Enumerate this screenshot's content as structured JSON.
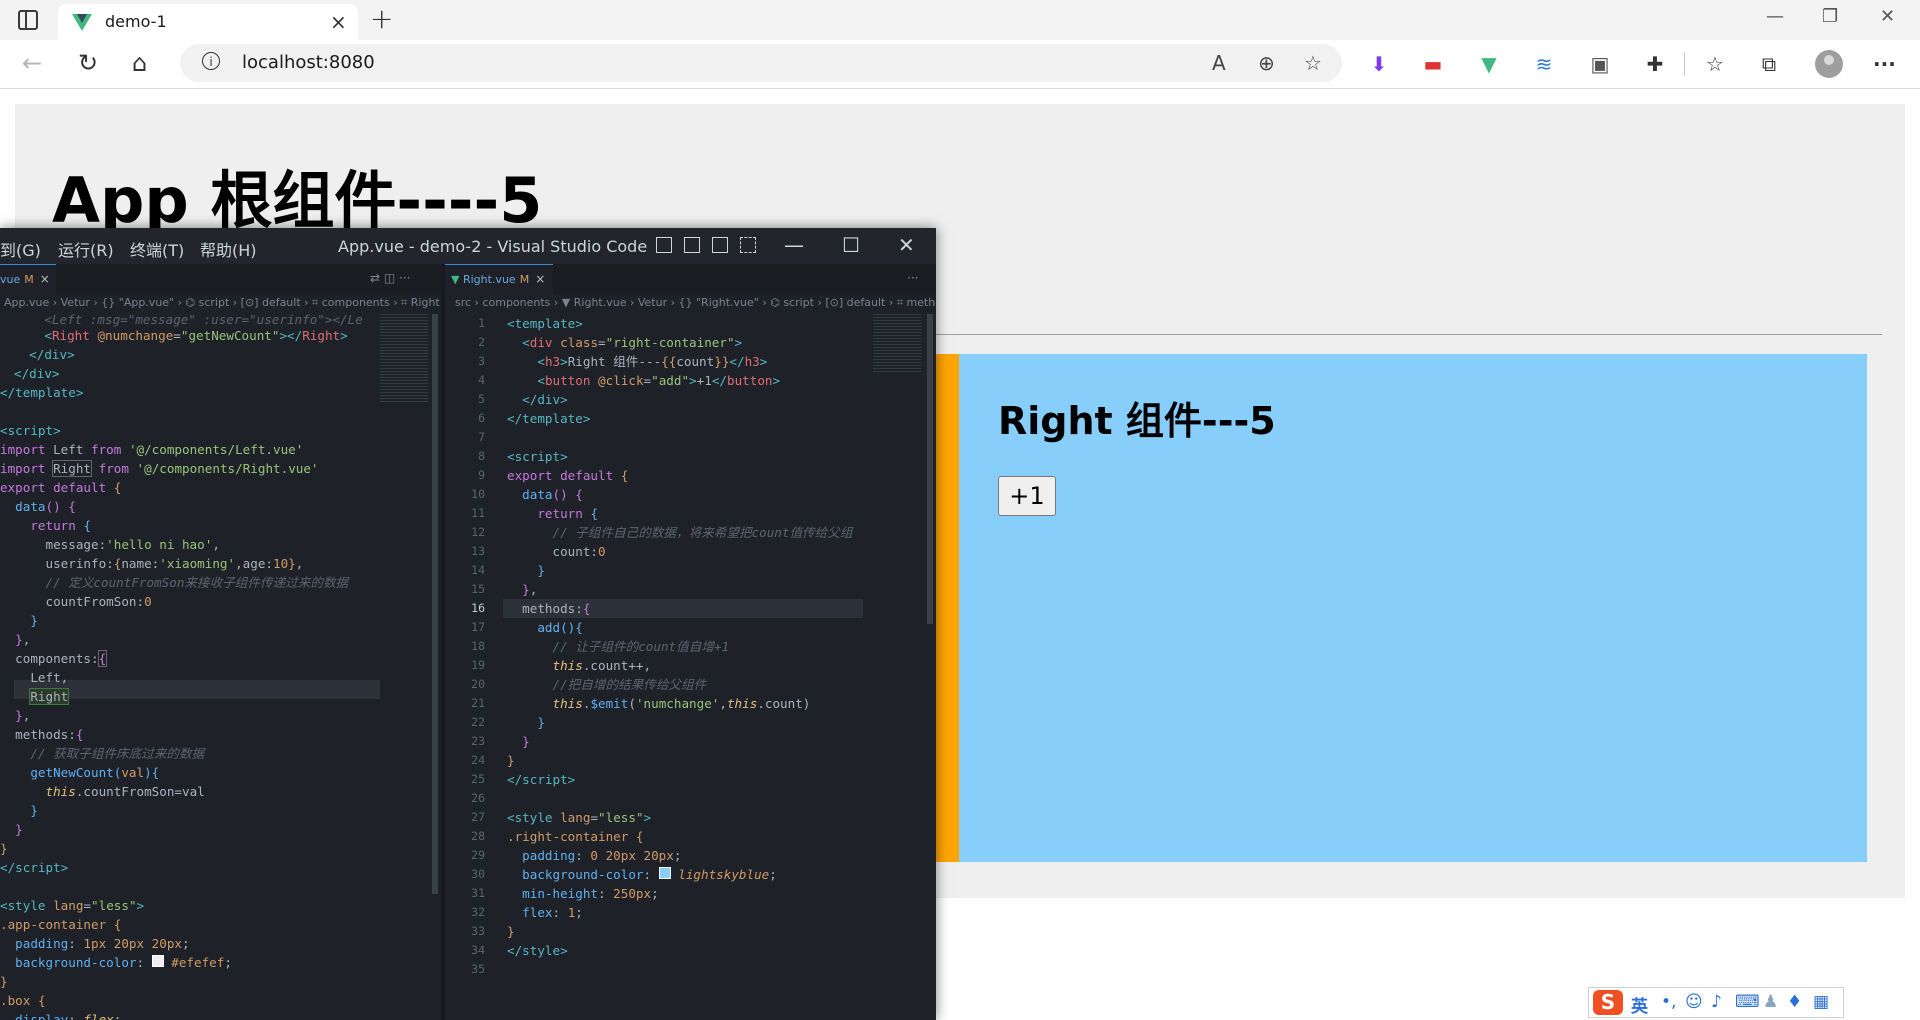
{
  "browser": {
    "tab": {
      "title": "demo-1",
      "close": "×",
      "favicon": "vue-logo-icon"
    },
    "new_tab": "+",
    "window_controls": {
      "minimize": "—",
      "restore": "❐",
      "close": "✕"
    },
    "nav": {
      "back": "←",
      "reload": "↻",
      "home": "⌂"
    },
    "url": "localhost:8080",
    "url_info": "i",
    "url_actions": {
      "read_aloud": "A",
      "zoom": "⊕",
      "favorite": "☆"
    },
    "extensions": [
      "download-arrow-icon",
      "video-icon",
      "vue-devtools-icon",
      "layers-icon",
      "tiles-icon",
      "puzzle-icon",
      "favorites-icon",
      "collections-icon"
    ],
    "more": "···"
  },
  "page": {
    "app_title": "App 根组件----5",
    "right_title": "Right 组件---5",
    "button_label": "+1",
    "colors": {
      "page_bg": "#efefef",
      "left_panel": "#ffa500",
      "right_panel": "#87cefa"
    }
  },
  "vscode": {
    "menus": [
      "到(G)",
      "运行(R)",
      "终端(T)",
      "帮助(H)"
    ],
    "title": "App.vue - demo-2 - Visual Studio Code",
    "window_controls": {
      "minimize": "—",
      "maximize": "☐",
      "close": "✕"
    },
    "left_tab": {
      "label": "vue",
      "modified": "M",
      "close": "×"
    },
    "right_tab": {
      "label": "Right.vue",
      "modified": "M",
      "close": "×"
    },
    "left_breadcrumb": "App.vue › Vetur › {} \"App.vue\" › ⌬ script › [⊙] default › ⌗ components › ⌗ Right",
    "right_breadcrumb": "src › components › ▼ Right.vue › Vetur › {} \"Right.vue\" › ⌬ script › [⊙] default › ⌗ metho",
    "tab_actions": "⇄ ◫ ···",
    "right_tab_actions": "···"
  },
  "ime": {
    "logo": "S",
    "lang": "英",
    "icons": [
      "punct-icon",
      "emoji-icon",
      "mic-icon",
      "keyboard-icon",
      "user-icon",
      "skin-icon",
      "grid-icon"
    ]
  }
}
